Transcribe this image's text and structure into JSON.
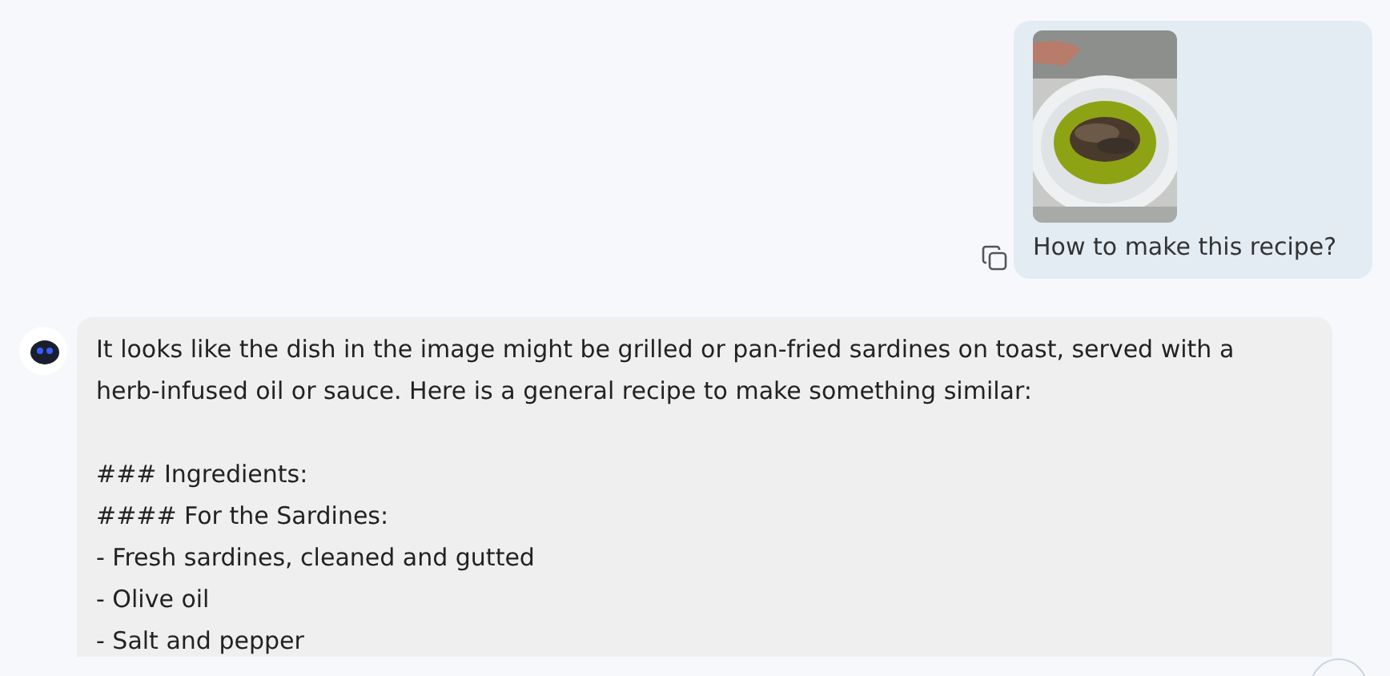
{
  "user_message": {
    "text": "How to make this recipe?"
  },
  "assistant_message": {
    "paragraphs": [
      {
        "lines": [
          "It looks like the dish in the image might be grilled or pan-fried sardines on toast, served with a herb-infused oil or sauce. Here is a general recipe to make something similar:"
        ]
      },
      {
        "lines": [
          "### Ingredients:",
          "#### For the Sardines:",
          "- Fresh sardines, cleaned and gutted",
          "- Olive oil",
          "- Salt and pepper"
        ]
      }
    ]
  }
}
